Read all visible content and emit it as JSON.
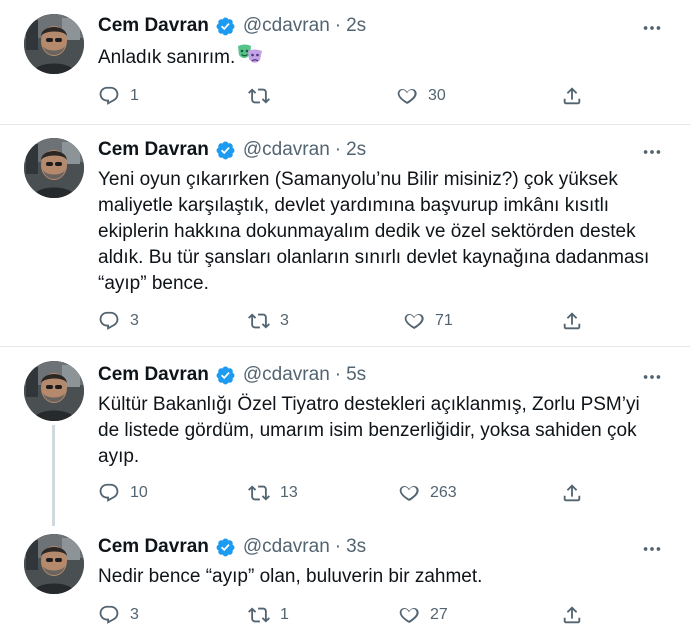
{
  "icons": {
    "reply": "reply-icon",
    "retweet": "retweet-icon",
    "like": "heart-icon",
    "share": "share-icon",
    "more": "more-icon",
    "verified": "verified-badge-icon"
  },
  "colors": {
    "verified": "#1d9bf0",
    "secondary_text": "#536471",
    "thread_line": "#cfd9de"
  },
  "tweets": [
    {
      "author": "Cem Davran",
      "handle": "@cdavran",
      "separator": "·",
      "time": "2s",
      "lines": [
        "Anladık sanırım."
      ],
      "emoji": "performing-arts-masks-emoji",
      "reply_count": "1",
      "retweet_count": "",
      "like_count": "30"
    },
    {
      "author": "Cem Davran",
      "handle": "@cdavran",
      "separator": "·",
      "time": "2s",
      "lines": [
        "Yeni oyun çıkarırken (Samanyolu’nu Bilir misiniz?) çok yüksek",
        "maliyetle karşılaştık, devlet yardımına başvurup imkânı kısıtlı",
        "ekiplerin hakkına dokunmayalım dedik ve özel sektörden destek",
        "aldık. Bu tür şansları olanların sınırlı devlet kaynağına dadanması",
        "“ayıp” bence."
      ],
      "reply_count": "3",
      "retweet_count": "3",
      "like_count": "71"
    },
    {
      "author": "Cem Davran",
      "handle": "@cdavran",
      "separator": "·",
      "time": "5s",
      "lines": [
        "Kültür Bakanlığı Özel Tiyatro destekleri açıklanmış, Zorlu PSM’yi",
        "de listede gördüm, umarım isim benzerliğidir, yoksa sahiden çok",
        "ayıp."
      ],
      "reply_count": "10",
      "retweet_count": "13",
      "like_count": "263"
    },
    {
      "author": "Cem Davran",
      "handle": "@cdavran",
      "separator": "·",
      "time": "3s",
      "lines": [
        "Nedir bence “ayıp” olan, buluverin bir zahmet."
      ],
      "reply_count": "3",
      "retweet_count": "1",
      "like_count": "27"
    }
  ]
}
